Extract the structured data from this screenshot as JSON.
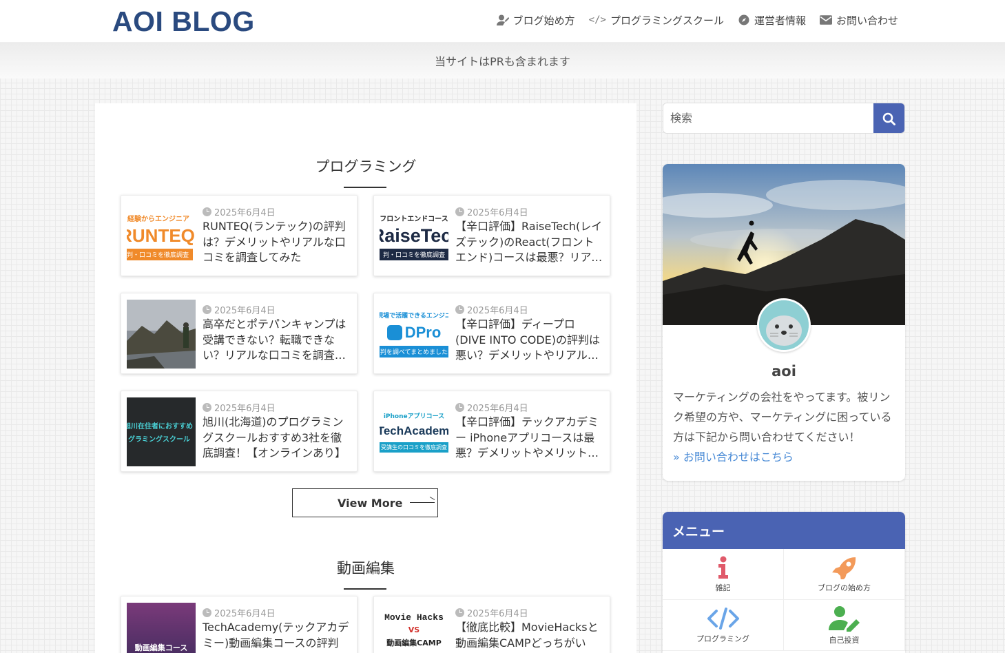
{
  "header": {
    "logo": "AOI BLOG",
    "nav": [
      {
        "label": "ブログ始め方",
        "icon": "user-edit-icon"
      },
      {
        "label": "プログラミングスクール",
        "icon": "code-icon"
      },
      {
        "label": "運営者情報",
        "icon": "compass-icon"
      },
      {
        "label": "お問い合わせ",
        "icon": "envelope-icon"
      }
    ],
    "pr_notice": "当サイトはPRも含まれます"
  },
  "sections": [
    {
      "title": "プログラミング",
      "posts": [
        {
          "date": "2025年6月4日",
          "title": "RUNTEQ(ランテック)の評判は？デメリットやリアルな口コミを調査してみた",
          "thumb_lines": [
            "経験からエンジニア",
            "RUNTEQ",
            "判・口コミを徹底調査"
          ]
        },
        {
          "date": "2025年6月4日",
          "title": "【辛口評価】RaiseTech(レイズテック)のReact(フロントエンド)コースは最悪？リアルな口コミを調査",
          "thumb_lines": [
            "フロントエンドコース",
            "RaiseTec",
            "判・口コミを徹底調査"
          ]
        },
        {
          "date": "2025年6月4日",
          "title": "高卒だとポテパンキャンプは受講できない？転職できない？リアルな口コミを調査してみた",
          "thumb_lines": []
        },
        {
          "date": "2025年6月4日",
          "title": "【辛口評価】ディープロ(DIVE INTO CODE)の評判は悪い？デメリットやリアルな口コミを調査",
          "thumb_lines": [
            "現場で活躍できるエンジニ",
            "DPro",
            "判を調べてまとめました"
          ]
        },
        {
          "date": "2025年6月4日",
          "title": "旭川(北海道)のプログラミングスクールおすすめ3社を徹底調査！【オンラインあり】",
          "thumb_lines": [
            "旭川在住者におすすめ",
            "グラミングスクール"
          ]
        },
        {
          "date": "2025年6月4日",
          "title": "【辛口評価】テックアカデミー iPhoneアプリコースは最悪？デメリットやメリットを調査",
          "thumb_lines": [
            "iPhoneアプリコース",
            "TechAcadem",
            "受講生の口コミを徹底調査"
          ]
        }
      ],
      "view_more": "View More"
    },
    {
      "title": "動画編集",
      "posts": [
        {
          "date": "2025年6月4日",
          "title": "TechAcademy(テックアカデミー)動画編集コースの評判は？",
          "thumb_lines": [
            "動画編集コース"
          ]
        },
        {
          "date": "2025年6月4日",
          "title": "【徹底比較】MovieHacksと動画編集CAMPどっちがいい？",
          "thumb_lines": [
            "Movie Hacks",
            "VS",
            "動画編集CAMP"
          ]
        }
      ]
    }
  ],
  "sidebar": {
    "search_placeholder": "検索",
    "profile": {
      "name": "aoi",
      "description": "マーケティングの会社をやってます。被リンク希望の方や、マーケティングに困っている方は下記から問い合わせてください！",
      "link": "» お問い合わせはこちら"
    },
    "menu": {
      "title": "メニュー",
      "items": [
        {
          "label": "雑記",
          "icon": "info-icon",
          "color": "#e05a6a"
        },
        {
          "label": "ブログの始め方",
          "icon": "rocket-icon",
          "color": "#f39a5a"
        },
        {
          "label": "プログラミング",
          "icon": "code-icon",
          "color": "#6aa5e8"
        },
        {
          "label": "自己投資",
          "icon": "user-edit-icon",
          "color": "#4caf50"
        }
      ]
    }
  },
  "colors": {
    "accent": "#4a63b3",
    "logo": "#2a4a7f",
    "link": "#4a8bd6"
  }
}
